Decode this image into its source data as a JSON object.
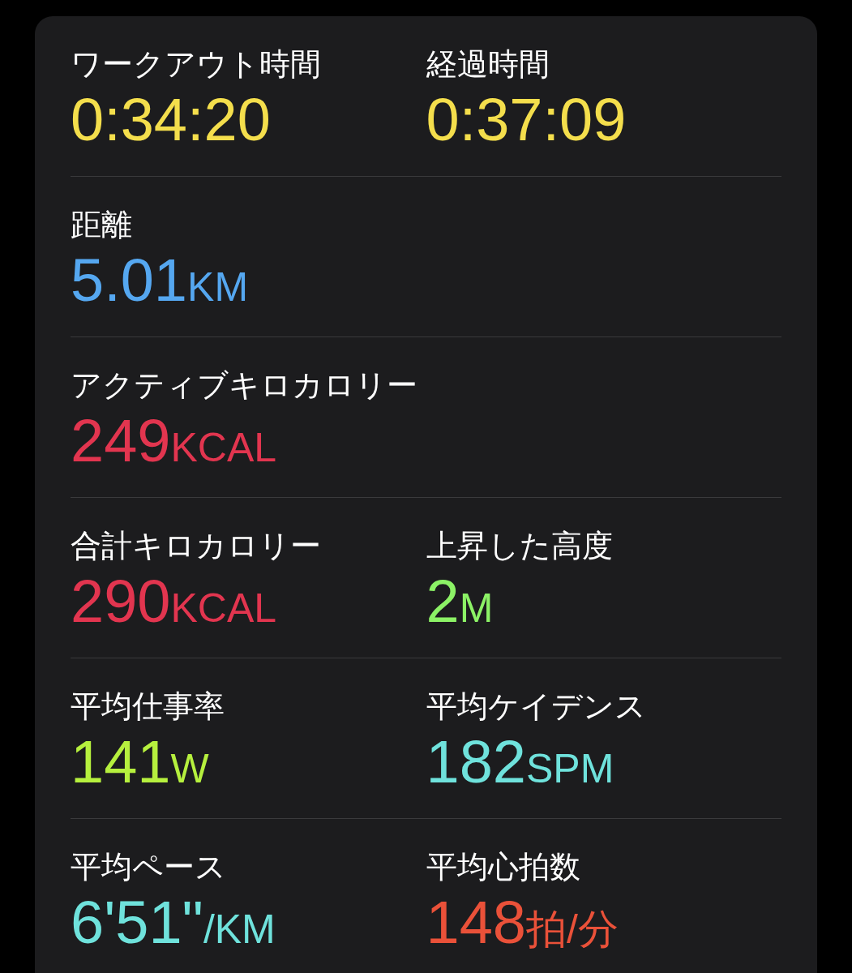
{
  "rows": [
    {
      "cells": [
        {
          "label": "ワークアウト時間",
          "value": "0:34:20",
          "color": "#f4de4c"
        },
        {
          "label": "経過時間",
          "value": "0:37:09",
          "color": "#f4de4c"
        }
      ]
    },
    {
      "cells": [
        {
          "label": "距離",
          "value": "5.01",
          "unit": "KM",
          "color": "#55a7f0"
        }
      ]
    },
    {
      "cells": [
        {
          "label": "アクティブキロカロリー",
          "value": "249",
          "unit": "KCAL",
          "color": "#e2354f"
        }
      ]
    },
    {
      "cells": [
        {
          "label": "合計キロカロリー",
          "value": "290",
          "unit": "KCAL",
          "color": "#e2354f"
        },
        {
          "label": "上昇した高度",
          "value": "2",
          "unit": "M",
          "color": "#8cf266"
        }
      ]
    },
    {
      "cells": [
        {
          "label": "平均仕事率",
          "value": "141",
          "unit": "W",
          "color": "#b6f03e"
        },
        {
          "label": "平均ケイデンス",
          "value": "182",
          "unit": "SPM",
          "color": "#6fe2dc"
        }
      ]
    },
    {
      "cells": [
        {
          "label": "平均ペース",
          "value": "6'51\"",
          "unit": "/KM",
          "color": "#6fe2dc"
        },
        {
          "label": "平均心拍数",
          "value": "148",
          "unit": "拍/分",
          "color": "#ea5139"
        }
      ]
    }
  ]
}
